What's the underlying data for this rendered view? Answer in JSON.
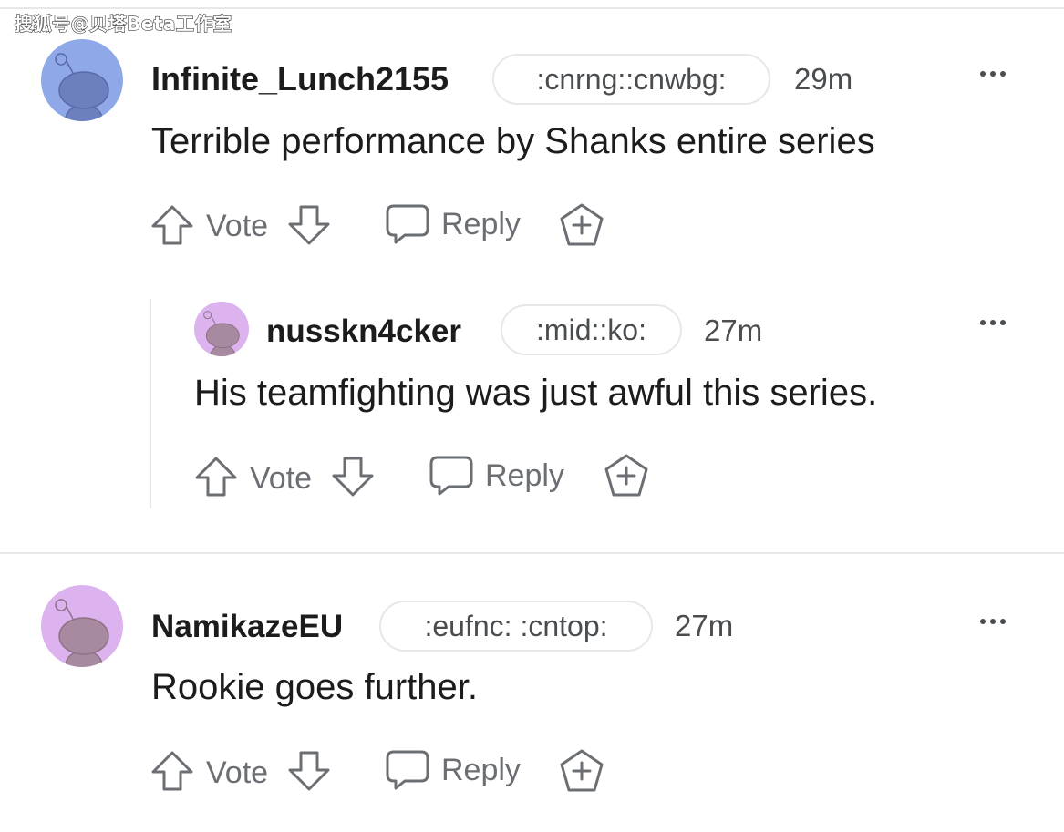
{
  "watermark": "搜狐号@贝塔Beta工作室",
  "comments": [
    {
      "username": "Infinite_Lunch2155",
      "flair": ":cnrng::cnwbg:",
      "time": "29m",
      "text": "Terrible performance by Shanks entire series",
      "vote_label": "Vote",
      "reply_label": "Reply",
      "avatar_color": "#8fa8e8"
    },
    {
      "username": "nusskn4cker",
      "flair": ":mid::ko:",
      "time": "27m",
      "text": "His teamfighting was just awful this series.",
      "vote_label": "Vote",
      "reply_label": "Reply",
      "avatar_color": "#dcb3ee"
    },
    {
      "username": "NamikazeEU",
      "flair": ":eufnc: :cntop:",
      "time": "27m",
      "text": "Rookie goes further.",
      "vote_label": "Vote",
      "reply_label": "Reply",
      "avatar_color": "#dcb3ee"
    }
  ],
  "icons": {
    "upvote": "arrow-up-outline-icon",
    "downvote": "arrow-down-outline-icon",
    "reply": "speech-bubble-icon",
    "award": "add-award-icon",
    "more": "ellipsis-icon",
    "avatar": "snoo-avatar-icon"
  }
}
